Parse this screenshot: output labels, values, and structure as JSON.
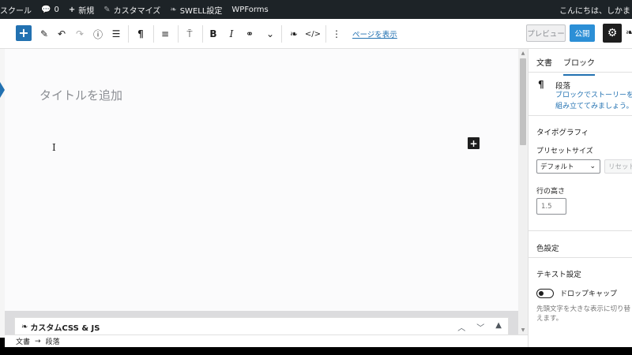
{
  "adminbar": {
    "site_label": "スクール",
    "comments_count": "0",
    "new_label": "新規",
    "customize_label": "カスタマイズ",
    "swell_label": "SWELL設定",
    "wpforms_label": "WPForms",
    "greeting": "こんにちは、しかま"
  },
  "toolbar": {
    "view_page_link": "ページを表示",
    "preview_label": "プレビュー",
    "publish_label": "公開"
  },
  "editor": {
    "title_placeholder": "タイトルを追加"
  },
  "metabox": {
    "title": "カスタムCSS & JS"
  },
  "breadcrumb": {
    "root": "文書",
    "arrow": "→",
    "current": "段落"
  },
  "sidebar": {
    "tab_document": "文書",
    "tab_block": "ブロック",
    "block_name": "段落",
    "block_description": "ブロックでストーリーを組み立ててみましょう。",
    "typography_heading": "タイポグラフィ",
    "preset_size_label": "プリセットサイズ",
    "preset_size_value": "デフォルト",
    "reset_label": "リセット",
    "line_height_label": "行の高さ",
    "line_height_value": "1.5",
    "color_heading": "色設定",
    "text_settings_heading": "テキスト設定",
    "drop_cap_label": "ドロップキャップ",
    "drop_cap_help": "先頭文字を大きな表示に切り替えます。"
  },
  "colors": {
    "accent": "#2271b1",
    "publish": "#2c8fd6",
    "adminbar": "#1d2327"
  }
}
